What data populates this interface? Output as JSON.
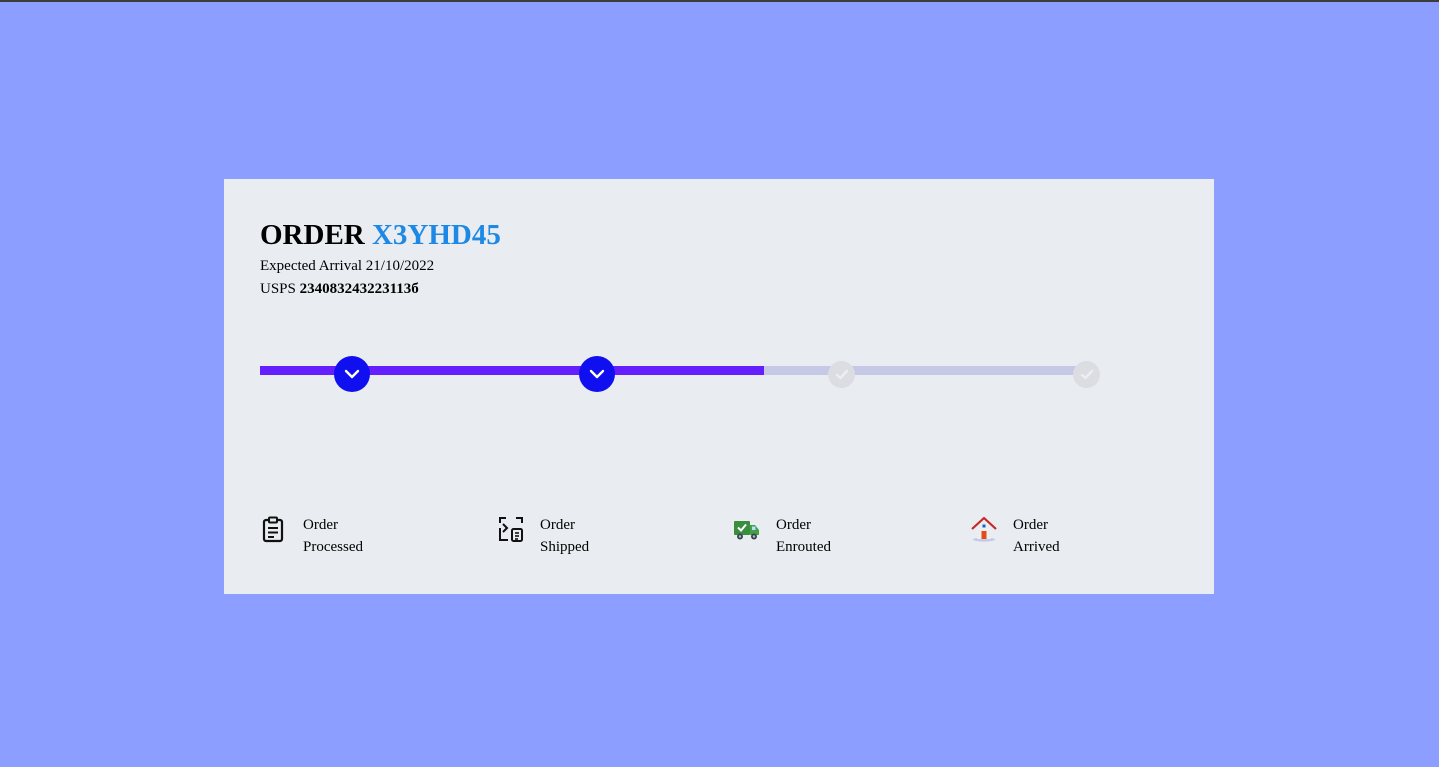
{
  "order": {
    "prefix": "ORDER",
    "id": "X3YHD45",
    "expected_arrival_label": "Expected Arrival",
    "expected_arrival_date": "21/10/2022",
    "carrier": "USPS",
    "tracking_number": "234083243223113б"
  },
  "progress": {
    "completed_steps": 2,
    "total_steps": 4,
    "fill_fraction": 0.61
  },
  "steps": [
    {
      "line1": "Order",
      "line2": "Processed",
      "status": "done",
      "icon": "clipboard-icon"
    },
    {
      "line1": "Order",
      "line2": "Shipped",
      "status": "done",
      "icon": "shipping-box-icon"
    },
    {
      "line1": "Order",
      "line2": "Enrouted",
      "status": "pending",
      "icon": "delivery-truck-icon"
    },
    {
      "line1": "Order",
      "line2": "Arrived",
      "status": "pending",
      "icon": "house-icon"
    }
  ],
  "colors": {
    "page_background": "#8c9eff",
    "card_background": "#e9edf1",
    "order_id": "#1e88e5",
    "progress_fill": "#651fff",
    "progress_track": "#c6c9e6",
    "step_done": "#0f0ff0",
    "step_pending": "#dcdde3"
  }
}
